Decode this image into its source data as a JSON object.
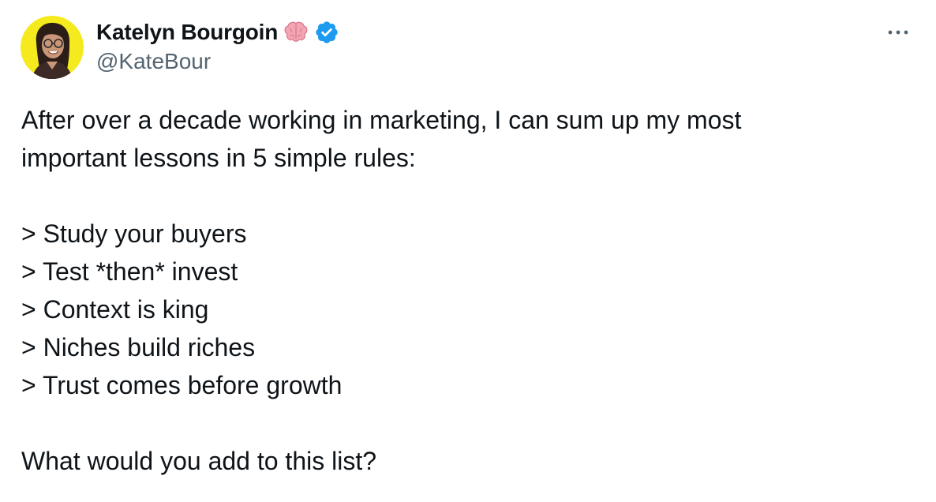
{
  "author": {
    "display_name": "Katelyn Bourgoin",
    "handle": "@KateBour",
    "badges": [
      "brain-emoji-icon",
      "verified-badge-icon"
    ],
    "avatar": "profile-photo-avatar"
  },
  "header": {
    "more_icon": "more-options-icon"
  },
  "tweet": {
    "intro_line_1": "After over a decade working in marketing, I can sum up my most",
    "intro_line_2": "important lessons in 5 simple rules:",
    "rules": [
      "> Study your buyers",
      "> Test *then* invest",
      "> Context is king",
      "> Niches build riches",
      "> Trust comes before growth"
    ],
    "closing": "What would you add to this list?"
  },
  "colors": {
    "text_primary": "#0f1419",
    "text_secondary": "#536471",
    "verified_blue": "#1d9bf0",
    "avatar_background": "#f5ea1e",
    "brain_pink": "#f4a4b4"
  }
}
